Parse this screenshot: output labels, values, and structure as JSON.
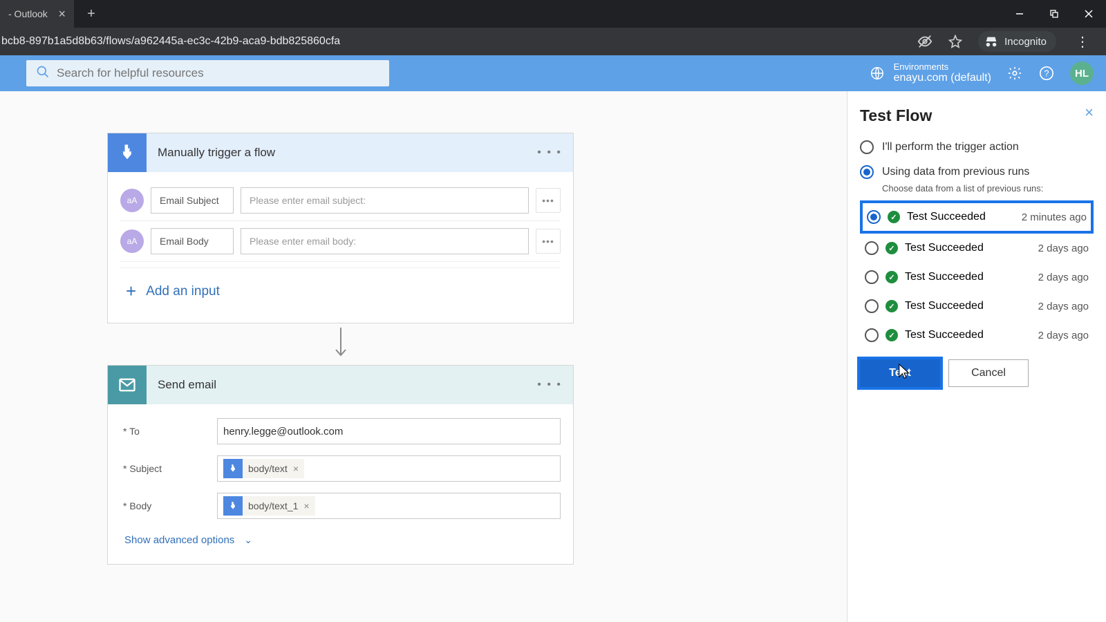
{
  "browser": {
    "tab_title": "- Outlook",
    "url": "bcb8-897b1a5d8b63/flows/a962445a-ec3c-42b9-aca9-bdb825860cfa",
    "incognito_label": "Incognito"
  },
  "appbar": {
    "search_placeholder": "Search for helpful resources",
    "env_label": "Environments",
    "env_value": "enayu.com (default)",
    "avatar": "HL"
  },
  "trigger_card": {
    "title": "Manually trigger a flow",
    "inputs": [
      {
        "label": "Email Subject",
        "placeholder": "Please enter email subject:"
      },
      {
        "label": "Email Body",
        "placeholder": "Please enter email body:"
      }
    ],
    "add_input": "Add an input"
  },
  "action_card": {
    "title": "Send email",
    "to_label": "* To",
    "to_value": "henry.legge@outlook.com",
    "subject_label": "* Subject",
    "subject_token": "body/text",
    "body_label": "* Body",
    "body_token": "body/text_1",
    "show_advanced": "Show advanced options"
  },
  "panel": {
    "title": "Test Flow",
    "opt_manual": "I'll perform the trigger action",
    "opt_previous": "Using data from previous runs",
    "sub": "Choose data from a list of previous runs:",
    "runs": [
      {
        "status": "Test Succeeded",
        "ago": "2 minutes ago"
      },
      {
        "status": "Test Succeeded",
        "ago": "2 days ago"
      },
      {
        "status": "Test Succeeded",
        "ago": "2 days ago"
      },
      {
        "status": "Test Succeeded",
        "ago": "2 days ago"
      },
      {
        "status": "Test Succeeded",
        "ago": "2 days ago"
      }
    ],
    "test_btn": "Test",
    "cancel_btn": "Cancel"
  }
}
